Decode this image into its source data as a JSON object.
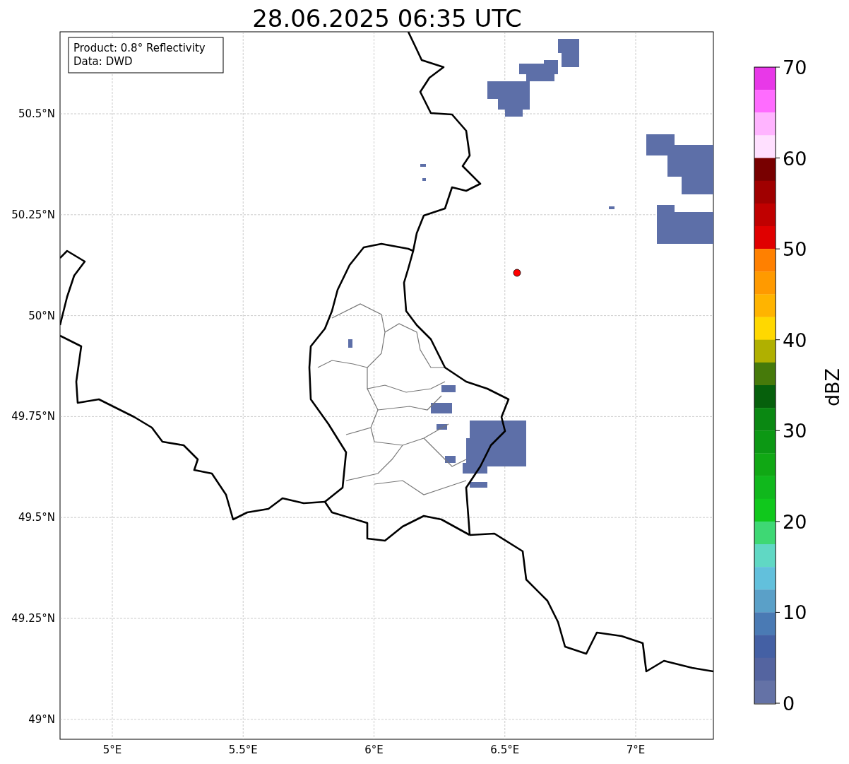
{
  "title": "28.06.2025 06:35 UTC",
  "legend": [
    "Product: 0.8° Reflectivity",
    "Data: DWD"
  ],
  "map": {
    "lat_labels": [
      "50.5°N",
      "50.25°N",
      "50°N",
      "49.75°N",
      "49.5°N",
      "49.25°N",
      "49°N"
    ],
    "lon_labels": [
      "5°E",
      "5.5°E",
      "6°E",
      "6.5°E",
      "7°E"
    ]
  },
  "colorbar": {
    "label": "dBZ",
    "tick_labels": [
      "70",
      "60",
      "50",
      "40",
      "30",
      "20",
      "10",
      "0"
    ],
    "bands": [
      {
        "color": "#e838e8"
      },
      {
        "color": "#ff6cff"
      },
      {
        "color": "#ffb4ff"
      },
      {
        "color": "#ffe0ff"
      },
      {
        "color": "#780000"
      },
      {
        "color": "#a00000"
      },
      {
        "color": "#c00000"
      },
      {
        "color": "#e00000"
      },
      {
        "color": "#ff8000"
      },
      {
        "color": "#ff9a00"
      },
      {
        "color": "#ffb400"
      },
      {
        "color": "#ffd800"
      },
      {
        "color": "#b0b000"
      },
      {
        "color": "#467a0a"
      },
      {
        "color": "#06600c"
      },
      {
        "color": "#0a8812"
      },
      {
        "color": "#0c9814"
      },
      {
        "color": "#10a814"
      },
      {
        "color": "#10b81c"
      },
      {
        "color": "#10c81c"
      },
      {
        "color": "#3ed874"
      },
      {
        "color": "#60d8c4"
      },
      {
        "color": "#62c0dc"
      },
      {
        "color": "#5aa0c8"
      },
      {
        "color": "#4a7ab4"
      },
      {
        "color": "#4460a4"
      },
      {
        "color": "#5464a0"
      },
      {
        "color": "#6472a6"
      }
    ]
  }
}
